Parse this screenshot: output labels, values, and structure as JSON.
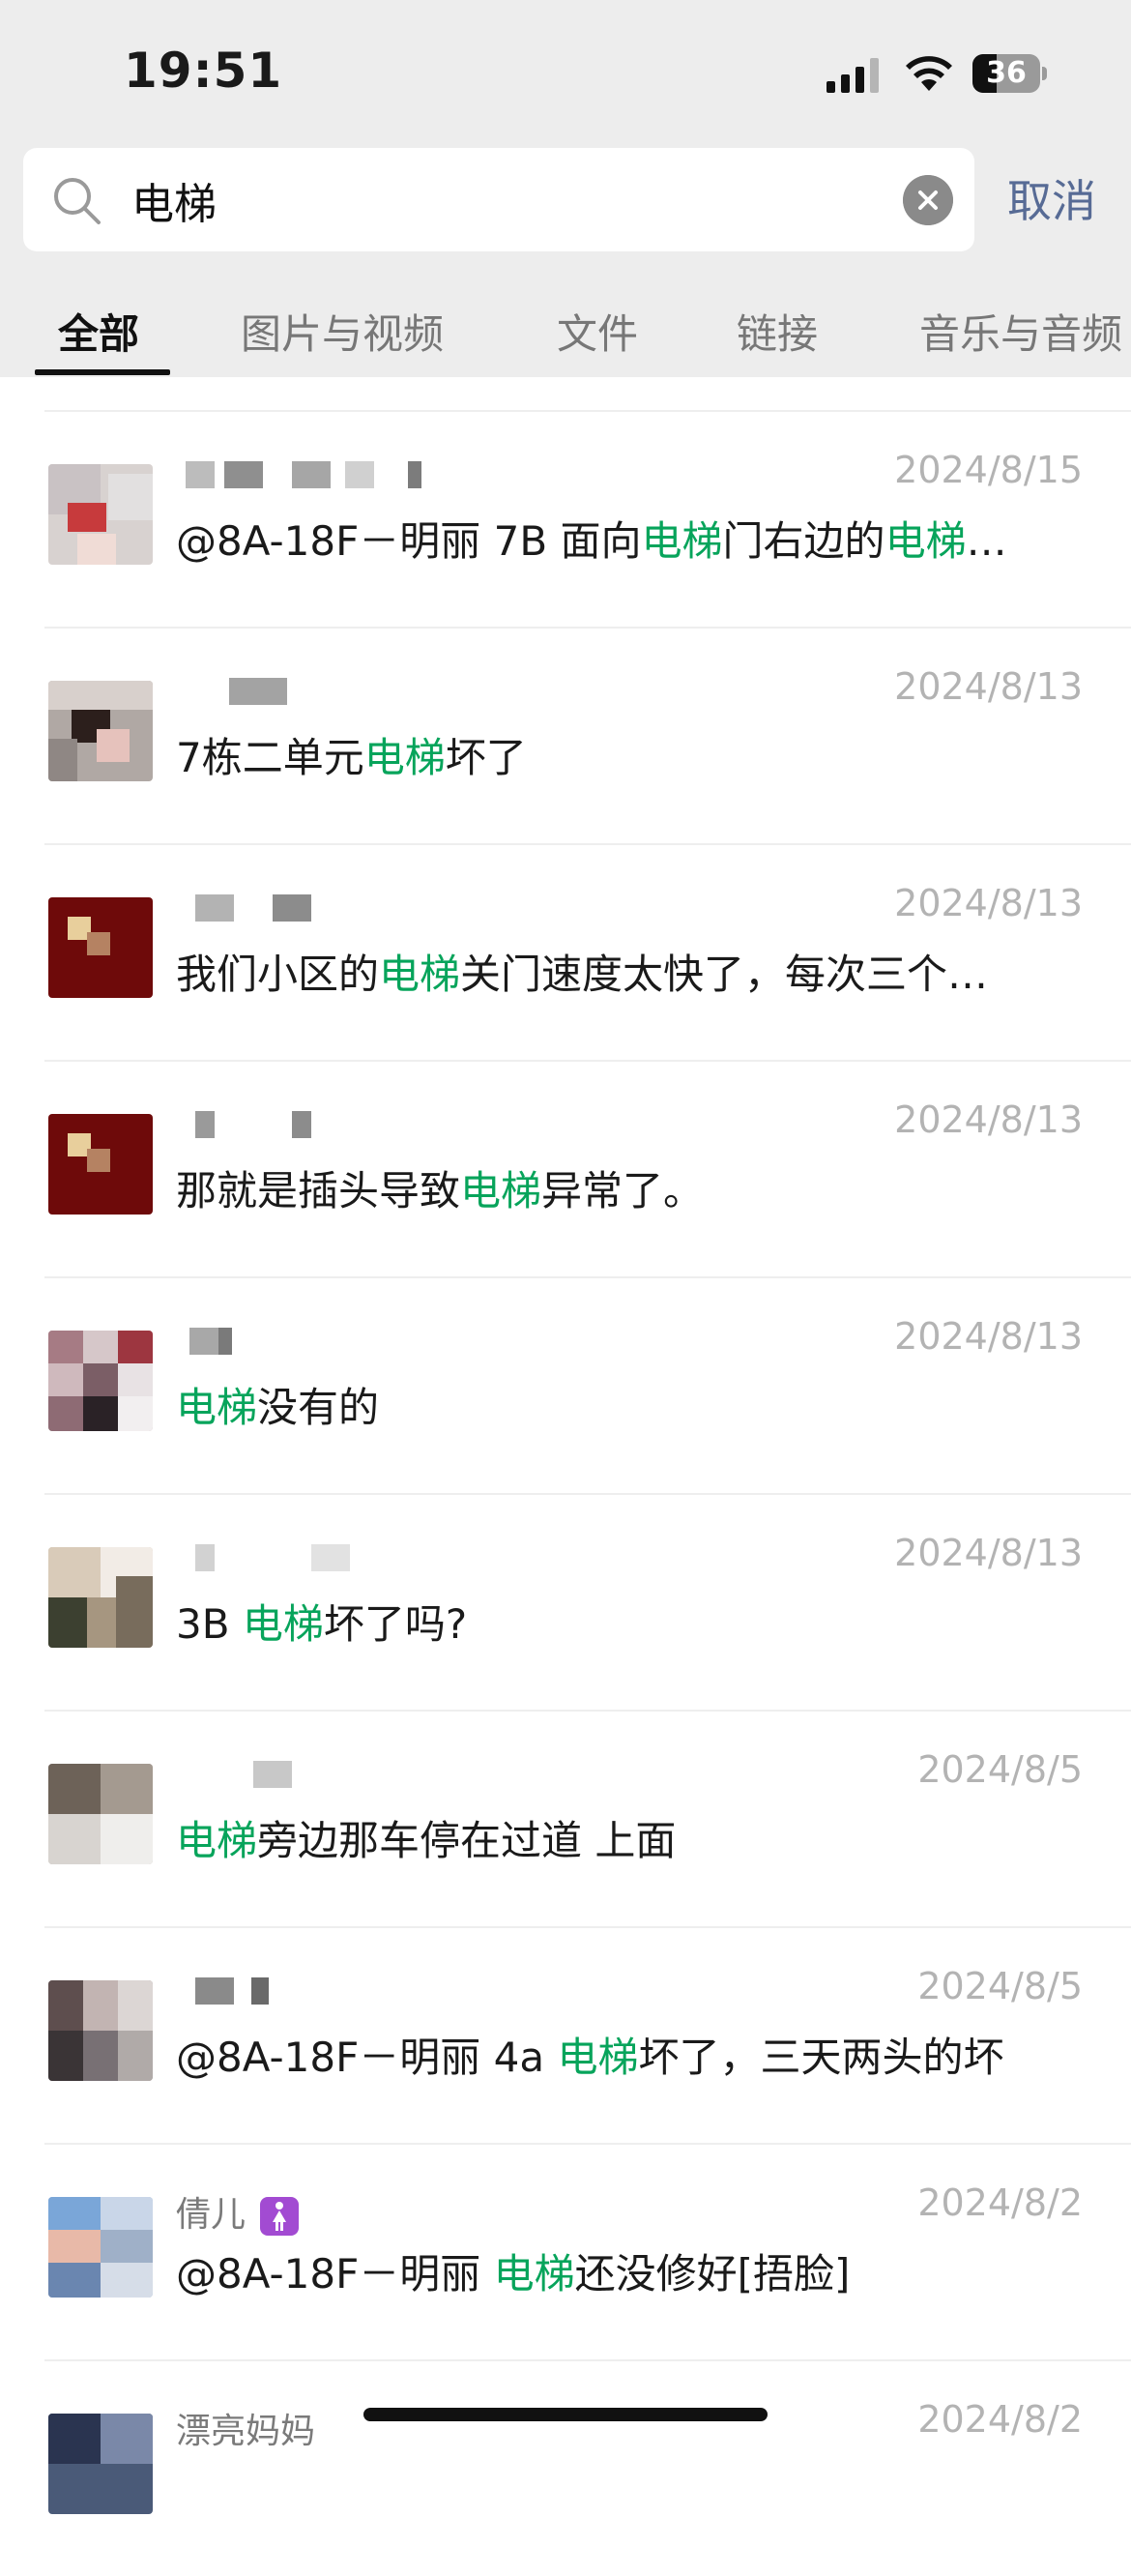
{
  "status_bar": {
    "time": "19:51",
    "battery": "36",
    "battery_level_percent": 36
  },
  "search": {
    "value": "电梯",
    "placeholder": "",
    "cancel_label": "取消"
  },
  "tabs": [
    {
      "label": "全部",
      "active": true
    },
    {
      "label": "图片与视频",
      "active": false
    },
    {
      "label": "文件",
      "active": false
    },
    {
      "label": "链接",
      "active": false
    },
    {
      "label": "音乐与音频",
      "active": false
    }
  ],
  "colors": {
    "highlight": "#07a45b",
    "link": "#576b95",
    "date": "#b3b3b3"
  },
  "results": [
    {
      "name": "",
      "date": "2024/8/15",
      "msg_pre": "@8A-18F－明丽 7B 面向",
      "hl1": "电梯",
      "msg_mid": "门右边的",
      "hl2": "电梯",
      "msg_post": "…"
    },
    {
      "name": "",
      "date": "2024/8/13",
      "msg_pre": "7栋二单元",
      "hl1": "电梯",
      "msg_mid": "坏了",
      "hl2": "",
      "msg_post": ""
    },
    {
      "name": "",
      "date": "2024/8/13",
      "msg_pre": "我们小区的",
      "hl1": "电梯",
      "msg_mid": "关门速度太快了，每次三个…",
      "hl2": "",
      "msg_post": ""
    },
    {
      "name": "",
      "date": "2024/8/13",
      "msg_pre": "那就是插头导致",
      "hl1": "电梯",
      "msg_mid": "异常了。",
      "hl2": "",
      "msg_post": ""
    },
    {
      "name": "",
      "date": "2024/8/13",
      "msg_pre": "",
      "hl1": "电梯",
      "msg_mid": "没有的",
      "hl2": "",
      "msg_post": ""
    },
    {
      "name": "",
      "date": "2024/8/13",
      "msg_pre": "3B ",
      "hl1": "电梯",
      "msg_mid": "坏了吗?",
      "hl2": "",
      "msg_post": ""
    },
    {
      "name": "",
      "date": "2024/8/5",
      "msg_pre": "",
      "hl1": "电梯",
      "msg_mid": "旁边那车停在过道 上面",
      "hl2": "",
      "msg_post": ""
    },
    {
      "name": "",
      "date": "2024/8/5",
      "msg_pre": "@8A-18F－明丽 4a ",
      "hl1": "电梯",
      "msg_mid": "坏了，三天两头的坏",
      "hl2": "",
      "msg_post": ""
    },
    {
      "name": "倩儿",
      "date": "2024/8/2",
      "msg_pre": "@8A-18F－明丽 ",
      "hl1": "电梯",
      "msg_mid": "还没修好[捂脸]",
      "hl2": "",
      "msg_post": ""
    },
    {
      "name": "漂亮妈妈",
      "date": "2024/8/2",
      "msg_pre": "",
      "hl1": "",
      "msg_mid": "",
      "hl2": "",
      "msg_post": ""
    }
  ]
}
